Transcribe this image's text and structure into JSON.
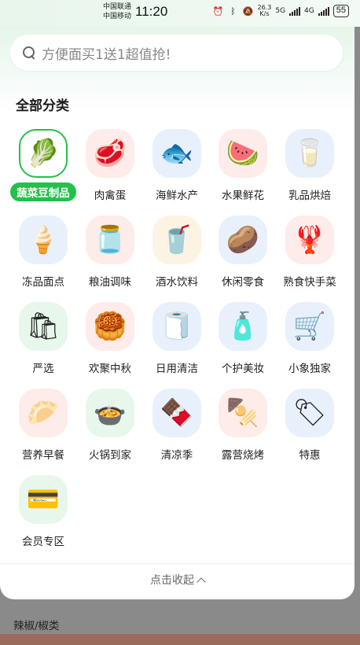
{
  "status_bar": {
    "carrier1": "中国联通",
    "carrier2": "中国移动",
    "time": "11:20",
    "net_speed_value": "26.3",
    "net_speed_unit": "K/s",
    "net1": "5G",
    "net2": "4G",
    "battery": "55"
  },
  "search": {
    "placeholder": "方便面买1送1超值抢!"
  },
  "section_title": "全部分类",
  "categories": [
    {
      "label": "蔬菜豆制品",
      "icon": "🥬",
      "bg": "#ffffff",
      "active": true
    },
    {
      "label": "肉禽蛋",
      "icon": "🥩",
      "bg": "#fdecea"
    },
    {
      "label": "海鲜水产",
      "icon": "🐟",
      "bg": "#e8f1fb"
    },
    {
      "label": "水果鲜花",
      "icon": "🍉",
      "bg": "#fdecea"
    },
    {
      "label": "乳品烘焙",
      "icon": "🥛",
      "bg": "#e8f1fb"
    },
    {
      "label": "冻品面点",
      "icon": "🍦",
      "bg": "#e8f1fb"
    },
    {
      "label": "粮油调味",
      "icon": "🫙",
      "bg": "#fdecea"
    },
    {
      "label": "酒水饮料",
      "icon": "🥤",
      "bg": "#fdf3e3"
    },
    {
      "label": "休闲零食",
      "icon": "🥔",
      "bg": "#e8f1fb"
    },
    {
      "label": "熟食快手菜",
      "icon": "🦞",
      "bg": "#fdecea"
    },
    {
      "label": "严选",
      "icon": "🛍",
      "bg": "#e8f7ec"
    },
    {
      "label": "欢聚中秋",
      "icon": "🥮",
      "bg": "#fdecea"
    },
    {
      "label": "日用清洁",
      "icon": "🧻",
      "bg": "#e8f1fb"
    },
    {
      "label": "个护美妆",
      "icon": "🧴",
      "bg": "#e8f1fb"
    },
    {
      "label": "小象独家",
      "icon": "🛒",
      "bg": "#e8f1fb"
    },
    {
      "label": "营养早餐",
      "icon": "🥟",
      "bg": "#fdecea"
    },
    {
      "label": "火锅到家",
      "icon": "🍲",
      "bg": "#e8f7ec"
    },
    {
      "label": "清凉季",
      "icon": "🍫",
      "bg": "#e8f1fb"
    },
    {
      "label": "露营烧烤",
      "icon": "🍢",
      "bg": "#fdecea"
    },
    {
      "label": "特惠",
      "icon": "🏷",
      "bg": "#e8f1fb"
    },
    {
      "label": "会员专区",
      "icon": "💳",
      "bg": "#e8f7ec"
    }
  ],
  "collapse_label": "点击收起",
  "below_section_label": "辣椒/椒类"
}
